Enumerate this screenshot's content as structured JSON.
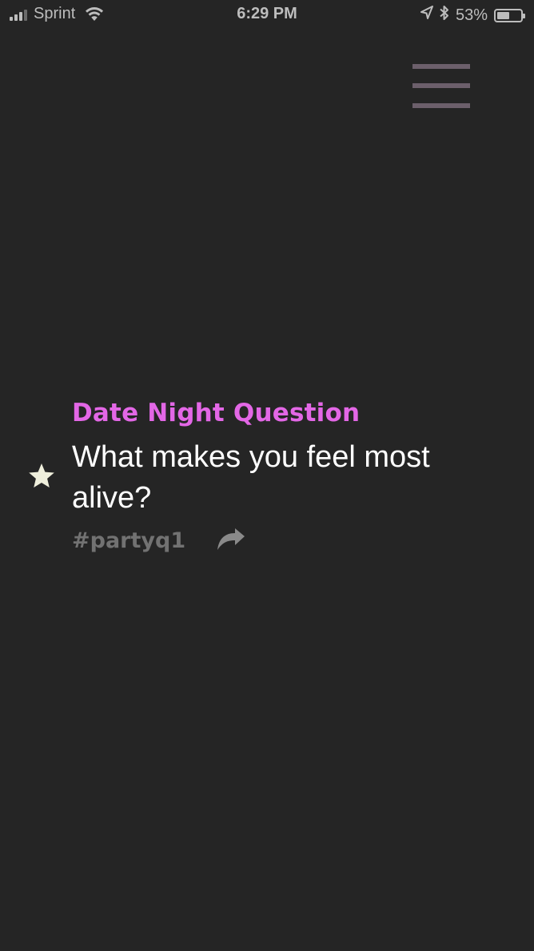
{
  "status_bar": {
    "carrier": "Sprint",
    "time": "6:29 PM",
    "battery_percent": "53%",
    "battery_level": 0.53,
    "signal_bars_active": 3,
    "signal_bars_total": 4,
    "icons": [
      "signal-icon",
      "wifi-icon",
      "location-arrow-icon",
      "bluetooth-icon",
      "battery-icon"
    ]
  },
  "menu": {
    "icon": "hamburger-menu-icon",
    "color": "#6c5f6b"
  },
  "card": {
    "category": "Date Night Question",
    "question": "What makes you feel most alive?",
    "hashtag": "#partyq1",
    "favorite_icon": "star-icon",
    "share_icon": "share-arrow-icon"
  },
  "colors": {
    "background": "#252525",
    "category": "#e367e6",
    "question": "#ffffff",
    "hashtag": "#727272",
    "star": "#efefdc",
    "share": "#8a8a8a"
  }
}
